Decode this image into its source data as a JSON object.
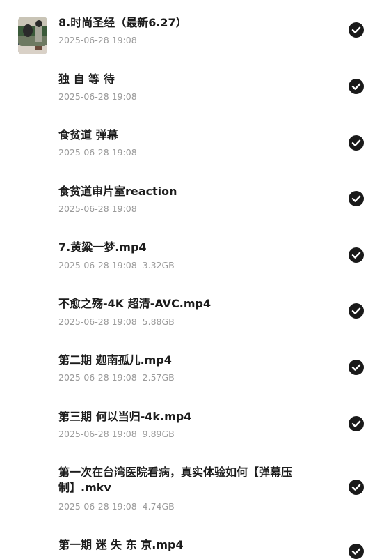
{
  "items": [
    {
      "kind": "folder",
      "name": "8.时尚圣经（最新6.27）",
      "date": "2025-06-28 19:08",
      "size": "",
      "selected": true,
      "icon": "folder-icon"
    },
    {
      "kind": "folder",
      "name": "独 自 等 待",
      "date": "2025-06-28 19:08",
      "size": "",
      "selected": true,
      "icon": "folder-icon"
    },
    {
      "kind": "folder",
      "name": "食贫道 弹幕",
      "date": "2025-06-28 19:08",
      "size": "",
      "selected": true,
      "icon": "folder-icon"
    },
    {
      "kind": "folder",
      "name": "食贫道审片室reaction",
      "date": "2025-06-28 19:08",
      "size": "",
      "selected": true,
      "icon": "folder-icon"
    },
    {
      "kind": "video",
      "name": "7.黄粱一梦.mp4",
      "date": "2025-06-28 19:08",
      "size": "3.32GB",
      "selected": true,
      "icon": "video-thumbnail"
    },
    {
      "kind": "video",
      "name": "不愈之殇-4K 超清-AVC.mp4",
      "date": "2025-06-28 19:08",
      "size": "5.88GB",
      "selected": true,
      "icon": "video-thumbnail"
    },
    {
      "kind": "video",
      "name": "第二期 迦南孤儿.mp4",
      "date": "2025-06-28 19:08",
      "size": "2.57GB",
      "selected": true,
      "icon": "video-thumbnail"
    },
    {
      "kind": "video",
      "name": "第三期 何以当归-4k.mp4",
      "date": "2025-06-28 19:08",
      "size": "9.89GB",
      "selected": true,
      "icon": "video-thumbnail"
    },
    {
      "kind": "video",
      "name": "第一次在台湾医院看病，真实体验如何【弹幕压制】.mkv",
      "date": "2025-06-28 19:08",
      "size": "4.74GB",
      "selected": true,
      "icon": "video-thumbnail"
    },
    {
      "kind": "video",
      "name": "第一期 迷 失 东 京.mp4",
      "date": "",
      "size": "",
      "selected": true,
      "icon": "video-thumbnail"
    }
  ],
  "colors": {
    "folder": "#6fb3f0",
    "folder_back": "#5aa2e6",
    "check": "#1a1a1a",
    "title": "#1c1c1c",
    "meta": "#9a9a9a"
  }
}
